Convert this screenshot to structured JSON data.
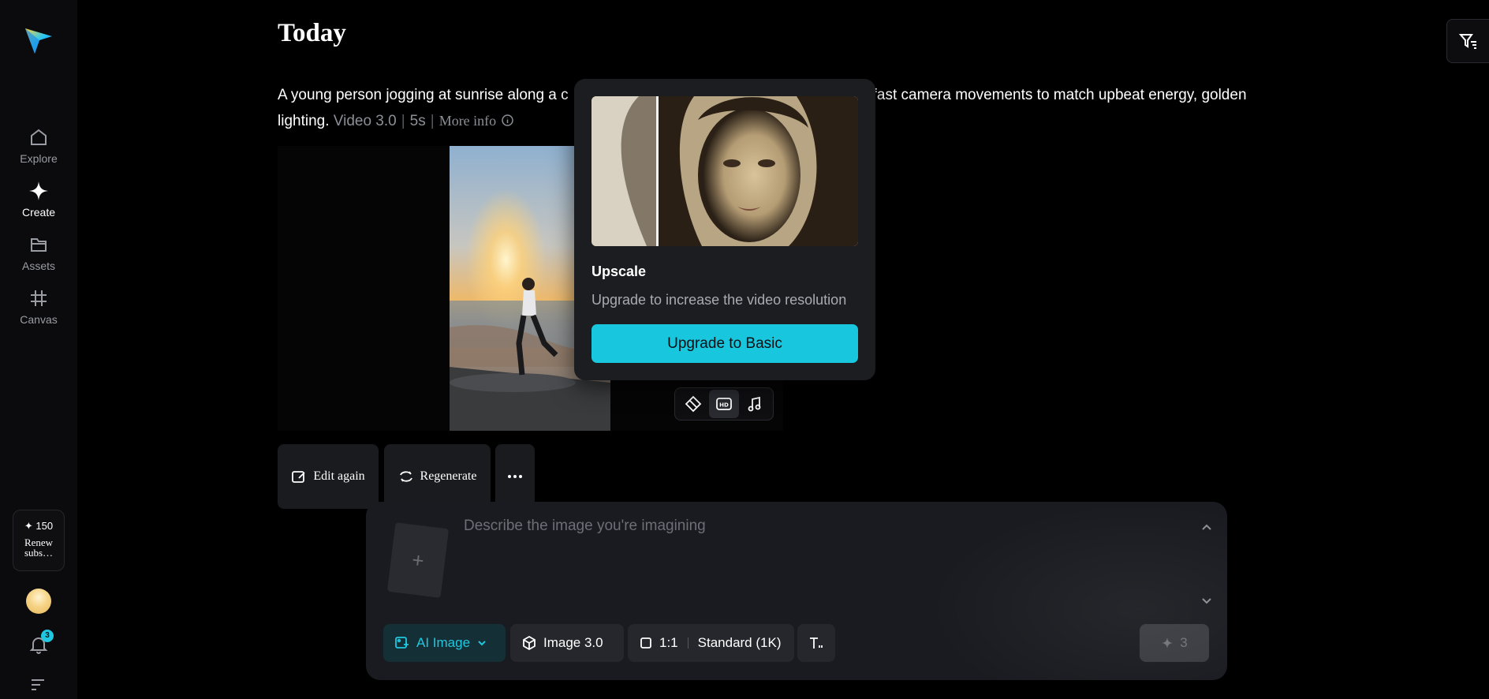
{
  "sidebar": {
    "nav": [
      {
        "label": "Explore",
        "icon": "home-icon"
      },
      {
        "label": "Create",
        "icon": "sparkle-icon"
      },
      {
        "label": "Assets",
        "icon": "folder-icon"
      },
      {
        "label": "Canvas",
        "icon": "frame-icon"
      }
    ],
    "credits": {
      "amount": "✦ 150",
      "renew": "Renew subs…"
    },
    "notifications_count": "3"
  },
  "main": {
    "title": "Today",
    "prompt": {
      "text_start": "A young person jogging at sunrise along a c",
      "text_end": "fast camera movements to match upbeat energy, golden lighting.",
      "model": "Video 3.0",
      "duration": "5s",
      "more_info": "More info"
    },
    "actions": {
      "edit_again": "Edit again",
      "regenerate": "Regenerate"
    }
  },
  "upscale_popup": {
    "title": "Upscale",
    "description": "Upgrade to increase the video resolution",
    "button": "Upgrade to Basic"
  },
  "composer": {
    "placeholder": "Describe the image you're imagining",
    "mode": "AI Image",
    "model": "Image 3.0",
    "ratio": "1:1",
    "quality": "Standard (1K)",
    "generate_cost": "3"
  },
  "colors": {
    "accent": "#18c7de",
    "background": "#000000",
    "panel": "#1a1b20"
  }
}
